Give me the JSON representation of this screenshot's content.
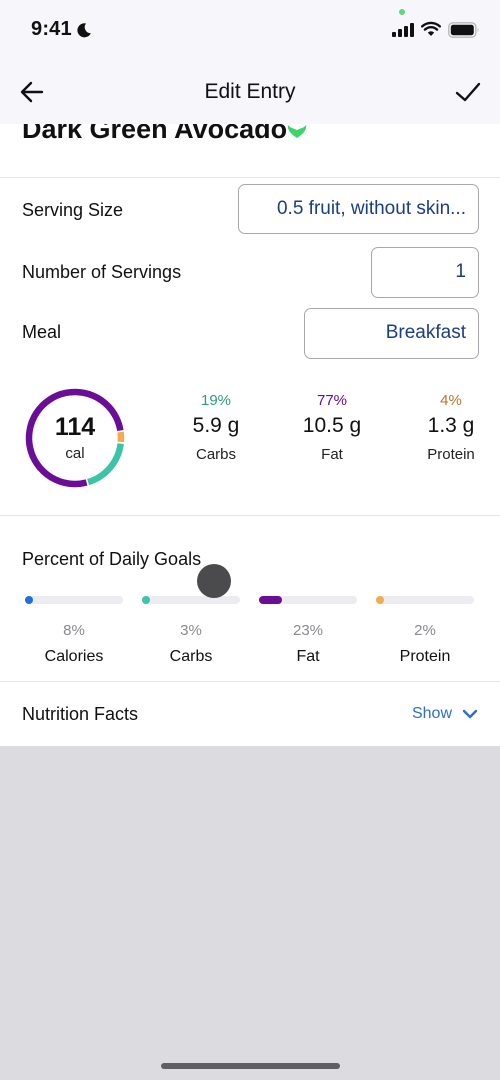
{
  "status_bar": {
    "time": "9:41",
    "focus_icon": "moon-icon",
    "icons": [
      "signal-icon",
      "wifi-icon",
      "battery-icon"
    ]
  },
  "nav": {
    "title": "Edit Entry",
    "back_icon": "arrow-left-icon",
    "confirm_icon": "checkmark-icon"
  },
  "food": {
    "title": "Dark Green Avocado",
    "badge_icon": "verified-heart-icon",
    "badge_color": "#3dd46b"
  },
  "fields": [
    {
      "label": "Serving Size",
      "value": "0.5 fruit, without skin..."
    },
    {
      "label": "Number of Servings",
      "value": "1"
    },
    {
      "label": "Meal",
      "value": "Breakfast"
    }
  ],
  "calories": {
    "value": "114",
    "unit": "cal"
  },
  "macros": [
    {
      "name": "Carbs",
      "percent": "19%",
      "percent_value": 19,
      "grams": "5.9 g",
      "color": "#3cc4a8",
      "pct_color": "#2f9a7e"
    },
    {
      "name": "Fat",
      "percent": "77%",
      "percent_value": 77,
      "grams": "10.5 g",
      "color": "#6a0d97",
      "pct_color": "#6a0d97"
    },
    {
      "name": "Protein",
      "percent": "4%",
      "percent_value": 4,
      "grams": "1.3 g",
      "color": "#f2ac4b",
      "pct_color": "#b8762c"
    }
  ],
  "daily_goals": {
    "title": "Percent of Daily Goals",
    "items": [
      {
        "name": "Calories",
        "percent": "8%",
        "value": 8,
        "color": "#1f6fe0"
      },
      {
        "name": "Carbs",
        "percent": "3%",
        "value": 3,
        "color": "#3cc4a8"
      },
      {
        "name": "Fat",
        "percent": "23%",
        "value": 23,
        "color": "#6a0d97"
      },
      {
        "name": "Protein",
        "percent": "2%",
        "value": 2,
        "color": "#f2ac4b"
      }
    ]
  },
  "nutrition_facts": {
    "label": "Nutrition Facts",
    "toggle_label": "Show",
    "toggle_icon": "chevron-down-icon"
  }
}
